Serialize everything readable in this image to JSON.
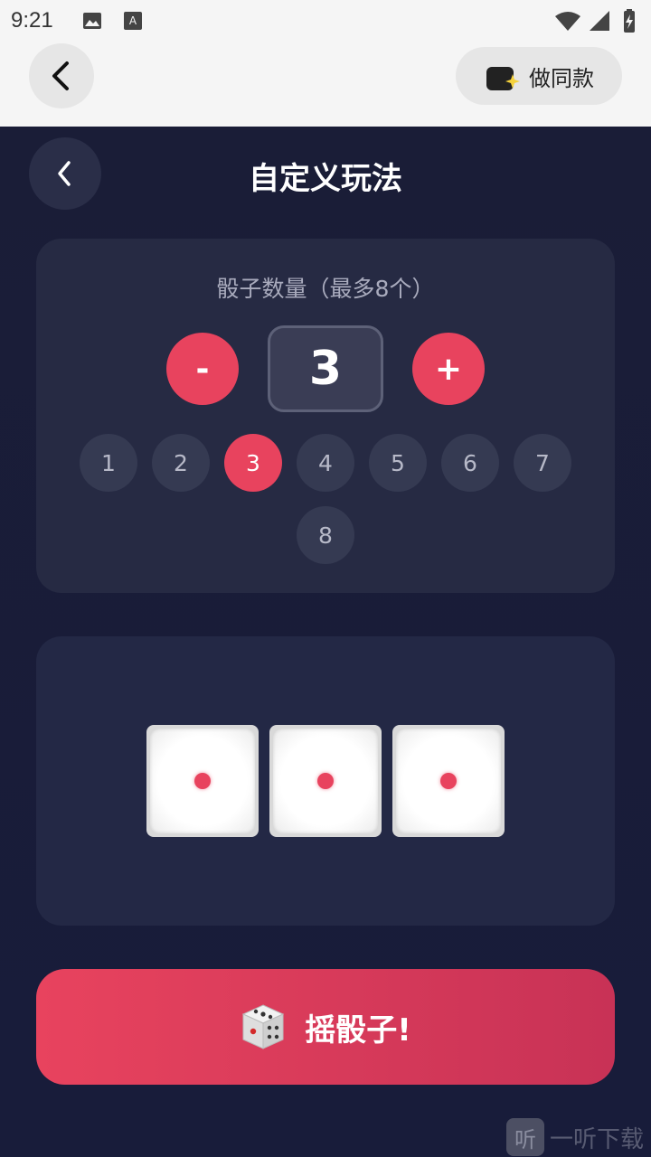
{
  "status_bar": {
    "time": "9:21"
  },
  "app_bar": {
    "same_label": "做同款"
  },
  "page": {
    "title": "自定义玩法"
  },
  "count_card": {
    "label": "骰子数量（最多8个）",
    "minus_label": "-",
    "plus_label": "+",
    "current_value": "3",
    "options": [
      "1",
      "2",
      "3",
      "4",
      "5",
      "6",
      "7",
      "8"
    ],
    "selected": "3"
  },
  "dice": [
    {
      "face": 1
    },
    {
      "face": 1
    },
    {
      "face": 1
    }
  ],
  "roll_button": {
    "label": "摇骰子!"
  },
  "watermark": {
    "text": "一听下载",
    "logo": "听"
  },
  "colors": {
    "accent": "#e8435e",
    "background": "#1b1f3a",
    "card": "#262a43"
  }
}
